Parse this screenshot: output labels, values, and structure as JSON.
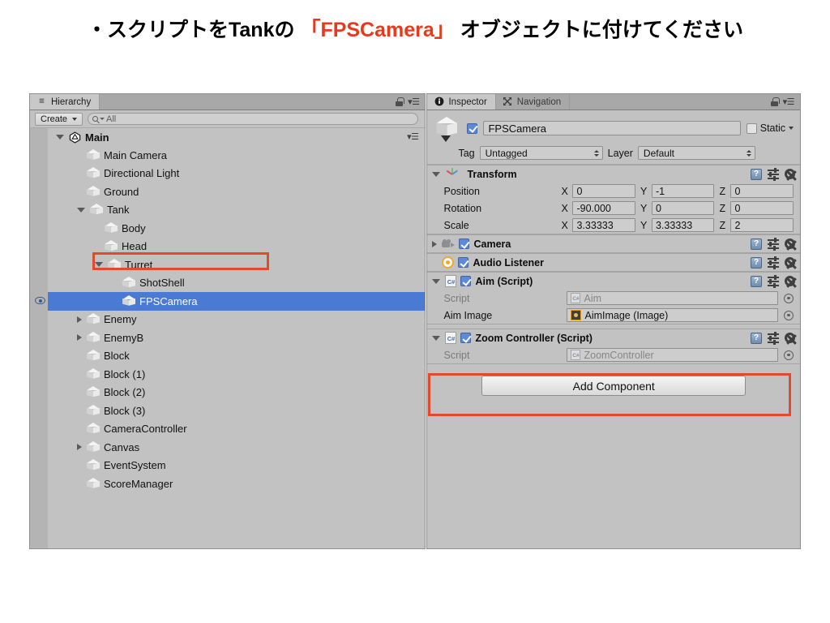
{
  "title": {
    "prefix": "・スクリプトをTankの ",
    "accent": "「FPSCamera」",
    "suffix": " オブジェクトに付けてください"
  },
  "colors": {
    "selection_blue": "#4a7ad4",
    "annotation_red": "#e04a2f",
    "panel_gray": "#c2c2c2",
    "accent_text_red": "#e8391c"
  },
  "hierarchy": {
    "tab_label": "Hierarchy",
    "tab_icon": "hierarchy-icon",
    "create_button": "Create",
    "search_placeholder": "All",
    "scene_name": "Main",
    "nodes": [
      {
        "label": "Main Camera",
        "depth": 1,
        "toggle": "none",
        "selected": false
      },
      {
        "label": "Directional Light",
        "depth": 1,
        "toggle": "none",
        "selected": false
      },
      {
        "label": "Ground",
        "depth": 1,
        "toggle": "none",
        "selected": false
      },
      {
        "label": "Tank",
        "depth": 1,
        "toggle": "expanded",
        "selected": false
      },
      {
        "label": "Body",
        "depth": 2,
        "toggle": "none",
        "selected": false
      },
      {
        "label": "Head",
        "depth": 2,
        "toggle": "none",
        "selected": false
      },
      {
        "label": "Turret",
        "depth": 2,
        "toggle": "expanded",
        "selected": false
      },
      {
        "label": "ShotShell",
        "depth": 3,
        "toggle": "none",
        "selected": false
      },
      {
        "label": "FPSCamera",
        "depth": 3,
        "toggle": "none",
        "selected": true
      },
      {
        "label": "Enemy",
        "depth": 1,
        "toggle": "collapsed",
        "selected": false
      },
      {
        "label": "EnemyB",
        "depth": 1,
        "toggle": "collapsed",
        "selected": false
      },
      {
        "label": "Block",
        "depth": 1,
        "toggle": "none",
        "selected": false
      },
      {
        "label": "Block (1)",
        "depth": 1,
        "toggle": "none",
        "selected": false
      },
      {
        "label": "Block (2)",
        "depth": 1,
        "toggle": "none",
        "selected": false
      },
      {
        "label": "Block (3)",
        "depth": 1,
        "toggle": "none",
        "selected": false
      },
      {
        "label": "CameraController",
        "depth": 1,
        "toggle": "none",
        "selected": false
      },
      {
        "label": "Canvas",
        "depth": 1,
        "toggle": "collapsed",
        "selected": false
      },
      {
        "label": "EventSystem",
        "depth": 1,
        "toggle": "none",
        "selected": false
      },
      {
        "label": "ScoreManager",
        "depth": 1,
        "toggle": "none",
        "selected": false
      }
    ]
  },
  "inspector": {
    "tabs": [
      {
        "label": "Inspector",
        "icon": "info-icon",
        "active": true
      },
      {
        "label": "Navigation",
        "icon": "navigation-icon",
        "active": false
      }
    ],
    "object_name": "FPSCamera",
    "object_enabled": true,
    "static_label": "Static",
    "static_checked": false,
    "tag_label": "Tag",
    "tag_value": "Untagged",
    "layer_label": "Layer",
    "layer_value": "Default",
    "transform": {
      "title": "Transform",
      "rows": [
        {
          "label": "Position",
          "x": "0",
          "y": "-1",
          "z": "0"
        },
        {
          "label": "Rotation",
          "x": "-90.000",
          "y": "0",
          "z": "0"
        },
        {
          "label": "Scale",
          "x": "3.33333",
          "y": "3.33333",
          "z": "2"
        }
      ],
      "axis_labels": {
        "x": "X",
        "y": "Y",
        "z": "Z"
      }
    },
    "components": [
      {
        "title": "Camera",
        "icon": "camera-icon",
        "enabled": true,
        "expanded": false
      },
      {
        "title": "Audio Listener",
        "icon": "audio-listener-icon",
        "enabled": true,
        "expanded": false
      }
    ],
    "aim_script": {
      "title": "Aim (Script)",
      "enabled": true,
      "script_label": "Script",
      "script_value": "Aim",
      "image_label": "Aim Image",
      "image_value": "AimImage (Image)"
    },
    "zoom_script": {
      "title": "Zoom Controller (Script)",
      "enabled": true,
      "script_label": "Script",
      "script_value": "ZoomController",
      "highlighted": true
    },
    "add_component_label": "Add Component"
  }
}
